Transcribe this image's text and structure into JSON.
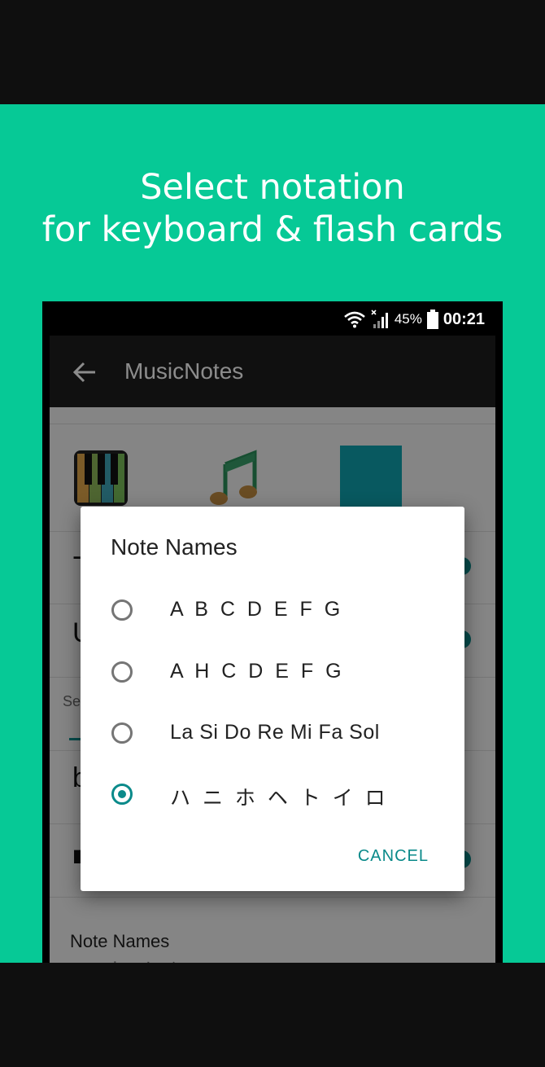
{
  "headline": {
    "line1": "Select notation",
    "line2": "for keyboard & flash cards"
  },
  "status_bar": {
    "battery_percent": "45%",
    "time": "00:21",
    "icons": [
      "wifi-icon",
      "signal-off-icon",
      "battery-icon"
    ]
  },
  "app_bar": {
    "title": "MusicNotes",
    "back_icon": "arrow-left-icon"
  },
  "background": {
    "tab_label": "Se",
    "setting_title": "Note Names",
    "setting_value": "ハニホヘトイロ"
  },
  "dialog": {
    "title": "Note Names",
    "options": [
      {
        "label": "A B C D E F G",
        "selected": false
      },
      {
        "label": "A H C D E F G",
        "selected": false
      },
      {
        "label": "La Si Do Re Mi Fa Sol",
        "selected": false
      },
      {
        "label": "ハ ニ ホ ヘ ト イ ロ",
        "selected": true
      }
    ],
    "cancel_label": "CANCEL"
  },
  "colors": {
    "background_green": "#06c996",
    "accent_teal": "#0a8a8a",
    "app_bar": "#1e1e1e"
  }
}
